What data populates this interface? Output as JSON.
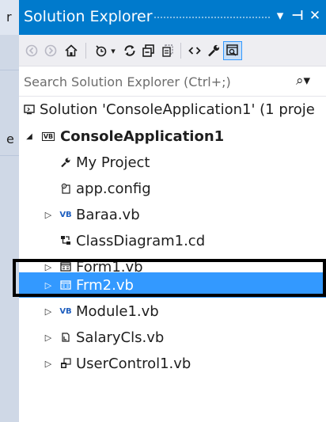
{
  "background": {
    "strip_chars": [
      "r",
      "e"
    ]
  },
  "window": {
    "title": "Solution Explorer",
    "buttons": {
      "dropdown": "▾",
      "pin": "⊣",
      "close": "✕"
    }
  },
  "toolbar": {
    "icons": [
      "back-icon",
      "forward-icon",
      "home-icon",
      "pending-changes-icon",
      "sync-icon",
      "collapse-all-icon",
      "show-all-files-icon",
      "view-code-icon",
      "properties-icon",
      "preview-icon"
    ]
  },
  "search": {
    "placeholder": "Search Solution Explorer (Ctrl+;)",
    "icon": "⌕▾"
  },
  "tree": {
    "solution": "Solution 'ConsoleApplication1' (1 proje",
    "project": "ConsoleApplication1",
    "items": [
      {
        "label": "My Project",
        "icon": "wrench-icon"
      },
      {
        "label": "app.config",
        "icon": "config-file-icon"
      },
      {
        "label": "Baraa.vb",
        "icon": "vb-file-icon"
      },
      {
        "label": "ClassDiagram1.cd",
        "icon": "class-diagram-icon"
      },
      {
        "label": "Form1.vb",
        "icon": "form-icon"
      },
      {
        "label": "Frm2.vb",
        "icon": "form-icon"
      },
      {
        "label": "Module1.vb",
        "icon": "vb-file-icon"
      },
      {
        "label": "SalaryCls.vb",
        "icon": "class-file-icon"
      },
      {
        "label": "UserControl1.vb",
        "icon": "user-control-icon"
      }
    ],
    "selected_item": "Frm2.vb"
  },
  "colors": {
    "titlebar": "#007acc",
    "selection": "#3399ff",
    "toolbar_bg": "#eeeef2"
  }
}
